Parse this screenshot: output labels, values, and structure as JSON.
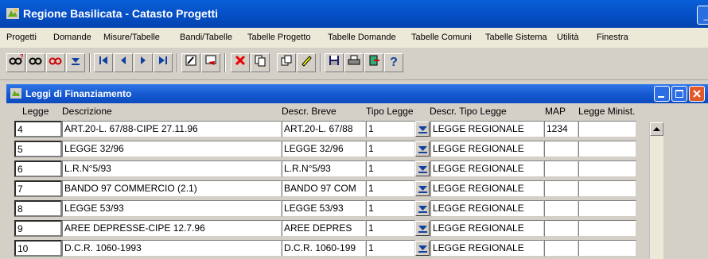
{
  "window": {
    "title": "Regione Basilicata - Catasto Progetti",
    "icon": "app-icon"
  },
  "menu": [
    "Progetti",
    "Domande",
    "Misure/Tabelle",
    "Bandi/Tabelle",
    "Tabelle Progetto",
    "Tabelle Domande",
    "Tabelle Comuni",
    "Tabelle Sistema",
    "Utilità",
    "Finestra"
  ],
  "toolbar": {
    "icons": [
      "query-enter-icon",
      "query-execute-icon",
      "query-cancel-icon",
      "list-values-icon",
      "first-record-icon",
      "previous-record-icon",
      "next-record-icon",
      "last-record-icon",
      "edit-icon",
      "clear-record-icon",
      "delete-icon",
      "duplicate-icon",
      "copy-icon",
      "edit-field-icon",
      "save-icon",
      "print-icon",
      "exit-icon",
      "help-icon"
    ]
  },
  "form": {
    "title": "Leggi di Finanziamento",
    "columns": [
      "Legge",
      "Descrizione",
      "Descr. Breve",
      "Tipo Legge",
      "Descr. Tipo Legge",
      "MAP",
      "Legge Minist."
    ],
    "rows": [
      {
        "legge": "4",
        "descrizione": "ART.20-L. 67/88-CIPE 27.11.96",
        "breve": "ART.20-L. 67/88",
        "tipo": "1",
        "descr_tipo": "LEGGE REGIONALE",
        "map": "1234",
        "minist": ""
      },
      {
        "legge": "5",
        "descrizione": "LEGGE 32/96",
        "breve": "LEGGE 32/96",
        "tipo": "1",
        "descr_tipo": "LEGGE REGIONALE",
        "map": "",
        "minist": ""
      },
      {
        "legge": "6",
        "descrizione": "L.R.N°5/93",
        "breve": "L.R.N°5/93",
        "tipo": "1",
        "descr_tipo": "LEGGE REGIONALE",
        "map": "",
        "minist": ""
      },
      {
        "legge": "7",
        "descrizione": "BANDO 97 COMMERCIO (2.1)",
        "breve": "BANDO 97 COM",
        "tipo": "1",
        "descr_tipo": "LEGGE REGIONALE",
        "map": "",
        "minist": ""
      },
      {
        "legge": "8",
        "descrizione": "LEGGE 53/93",
        "breve": "LEGGE 53/93",
        "tipo": "1",
        "descr_tipo": "LEGGE REGIONALE",
        "map": "",
        "minist": ""
      },
      {
        "legge": "9",
        "descrizione": "AREE DEPRESSE-CIPE 12.7.96",
        "breve": "AREE DEPRES",
        "tipo": "1",
        "descr_tipo": "LEGGE REGIONALE",
        "map": "",
        "minist": ""
      },
      {
        "legge": "10",
        "descrizione": "D.C.R. 1060-1993",
        "breve": "D.C.R. 1060-199",
        "tipo": "1",
        "descr_tipo": "LEGGE REGIONALE",
        "map": "",
        "minist": ""
      }
    ]
  },
  "colors": {
    "titlebar": "#0550c8",
    "form_bg": "#d4d0c8",
    "accent": "#0a246a"
  }
}
